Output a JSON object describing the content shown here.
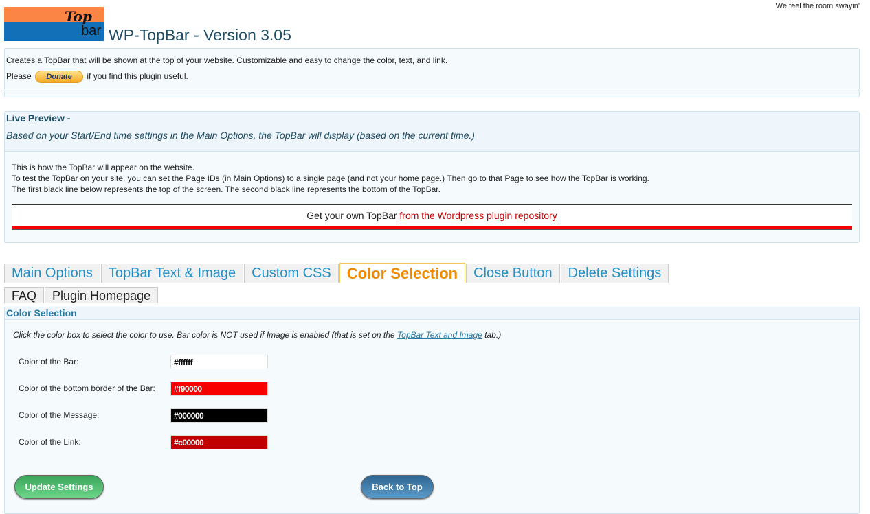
{
  "tagline": "We feel the room swayin'",
  "logo": {
    "line1": "Top",
    "line2": "bar"
  },
  "title": "WP-TopBar - Version 3.05",
  "intro": {
    "text": "Creates a TopBar that will be shown at the top of your website. Customizable and easy to change the color, text, and link.",
    "please": "Please",
    "donate": "Donate",
    "after": "if you find this plugin useful."
  },
  "preview": {
    "heading": "Live Preview -",
    "subtitle": "Based on your Start/End time settings in the Main Options, the TopBar will display (based on the current time.)",
    "lines": [
      "This is how the TopBar will appear on the website.",
      "To test the TopBar on your site, you can set the Page IDs (in Main Options) to a single page (and not your home page.) Then go to that Page to see how the TopBar is working.",
      "The first black line below represents the top of the screen. The second black line represents the bottom of the TopBar."
    ],
    "bar_text": "Get your own TopBar",
    "bar_link": "from the Wordpress plugin repository"
  },
  "tabs": [
    "Main Options",
    "TopBar Text & Image",
    "Custom CSS",
    "Color Selection",
    "Close Button",
    "Delete Settings"
  ],
  "tabs2": [
    "FAQ",
    "Plugin Homepage"
  ],
  "color_section": {
    "heading": "Color Selection",
    "desc": "Click the color box to select the color to use. Bar color is NOT used if Image is enabled (that is set on the",
    "desc_link": "TopBar Text and Image",
    "desc_end": "tab.)",
    "fields": [
      {
        "label": "Color of the Bar:",
        "value": "#ffffff"
      },
      {
        "label": "Color of the bottom border of the Bar:",
        "value": "#f90000"
      },
      {
        "label": "Color of the Message:",
        "value": "#000000"
      },
      {
        "label": "Color of the Link:",
        "value": "#c00000"
      }
    ],
    "update": "Update Settings",
    "back": "Back to Top"
  }
}
